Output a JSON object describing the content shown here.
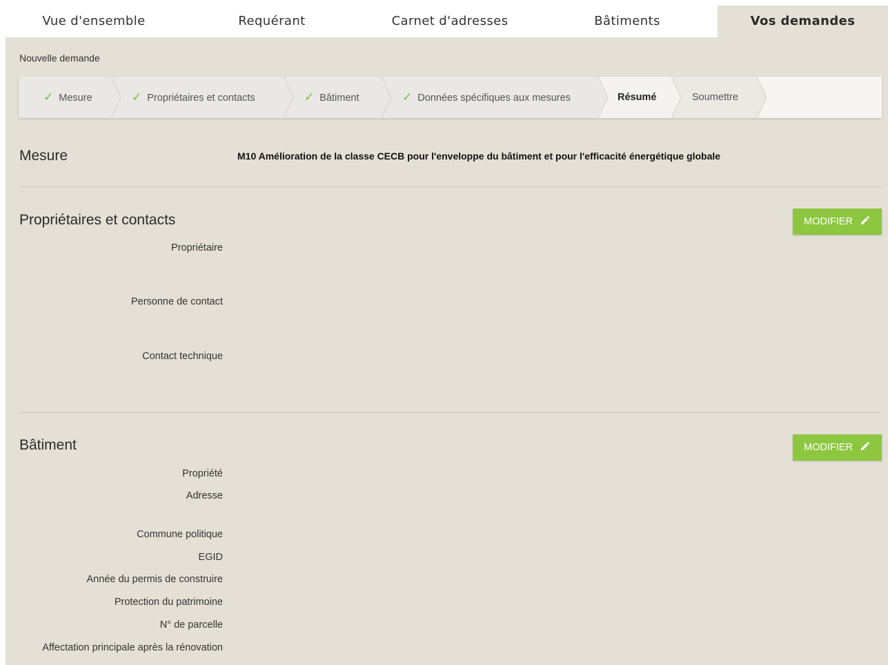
{
  "nav": {
    "tabs": [
      {
        "label": "Vue d'ensemble"
      },
      {
        "label": "Requérant"
      },
      {
        "label": "Carnet d'adresses"
      },
      {
        "label": "Bâtiments"
      },
      {
        "label": "Vos demandes",
        "active": true
      }
    ]
  },
  "page": {
    "subtitle": "Nouvelle demande"
  },
  "stepper": {
    "steps": [
      {
        "label": "Mesure",
        "state": "done"
      },
      {
        "label": "Propriétaires et contacts",
        "state": "done"
      },
      {
        "label": "Bâtiment",
        "state": "done"
      },
      {
        "label": "Données spécifiques aux mesures",
        "state": "done"
      },
      {
        "label": "Résumé",
        "state": "current"
      },
      {
        "label": "Soumettre",
        "state": "pending"
      }
    ]
  },
  "mesure": {
    "title": "Mesure",
    "value": "M10 Amélioration de la classe CECB pour l'enveloppe du bâtiment et pour l'efficacité énergétique globale"
  },
  "proprietaires": {
    "title": "Propriétaires et contacts",
    "button": "MODIFIER",
    "labels": [
      "Propriétaire",
      "Personne de contact",
      "Contact technique"
    ]
  },
  "batiment": {
    "title": "Bâtiment",
    "button": "MODIFIER",
    "labels": [
      "Propriété",
      "Adresse",
      "Commune politique",
      "EGID",
      "Année du permis de construire",
      "Protection du patrimoine",
      "N° de parcelle",
      "Affectation principale après la rénovation"
    ]
  },
  "colors": {
    "panel": "#e4e0d5",
    "accent_green": "#8dc63f",
    "check_green": "#76bb3f"
  },
  "icons": [
    "check-icon",
    "pencil-icon"
  ]
}
